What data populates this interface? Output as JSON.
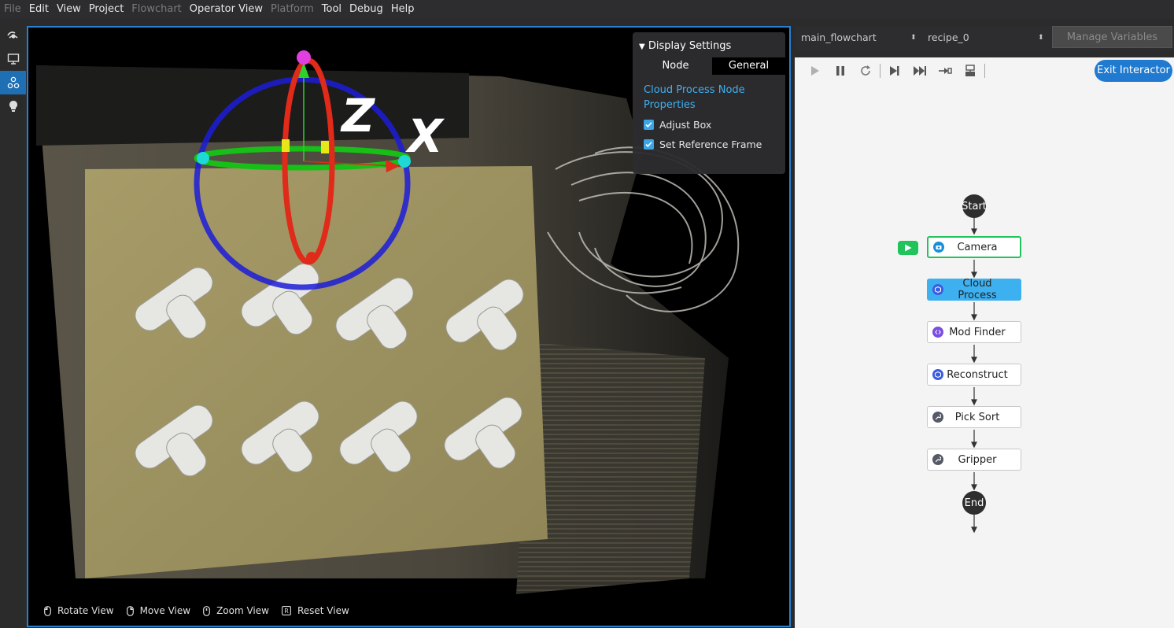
{
  "menu": [
    {
      "label": "File",
      "enabled": false
    },
    {
      "label": "Edit",
      "enabled": true
    },
    {
      "label": "View",
      "enabled": true
    },
    {
      "label": "Project",
      "enabled": true
    },
    {
      "label": "Flowchart",
      "enabled": false
    },
    {
      "label": "Operator View",
      "enabled": true
    },
    {
      "label": "Platform",
      "enabled": false
    },
    {
      "label": "Tool",
      "enabled": true
    },
    {
      "label": "Debug",
      "enabled": true
    },
    {
      "label": "Help",
      "enabled": true
    }
  ],
  "sidebar": {
    "items": [
      {
        "icon": "eye-icon",
        "active": false
      },
      {
        "icon": "monitor-icon",
        "active": false
      },
      {
        "icon": "flowchart-icon",
        "active": true
      },
      {
        "icon": "lightbulb-icon",
        "active": false
      }
    ]
  },
  "viewport": {
    "gizmo_labels": {
      "z": "Z",
      "x": "X"
    },
    "display_settings": {
      "title": "Display Settings",
      "tabs": [
        {
          "label": "Node",
          "active": false
        },
        {
          "label": "General",
          "active": true
        }
      ],
      "section_title": "Cloud Process Node Properties",
      "checkboxes": [
        {
          "label": "Adjust Box",
          "checked": true
        },
        {
          "label": "Set Reference Frame",
          "checked": true
        }
      ]
    },
    "hints": [
      {
        "icon": "mouse-left-icon",
        "label": "Rotate View"
      },
      {
        "icon": "mouse-right-icon",
        "label": "Move View"
      },
      {
        "icon": "mouse-wheel-icon",
        "label": "Zoom View"
      },
      {
        "icon": "key-r-icon",
        "label": "Reset View"
      }
    ]
  },
  "flow_panel": {
    "flowchart_select": "main_flowchart",
    "recipe_select": "recipe_0",
    "manage_variables": "Manage Variables",
    "exit_interactor": "Exit Interactor",
    "toolbar": [
      "play-icon",
      "pause-icon",
      "reset-icon",
      "step-icon",
      "fast-forward-icon",
      "step-into-icon",
      "breakpoint-icon"
    ],
    "start_label": "Start",
    "end_label": "End",
    "nodes": [
      {
        "label": "Camera",
        "icon": "camera-icon",
        "icon_color": "#1a8fd8",
        "state": "running"
      },
      {
        "label": "Cloud Process",
        "icon": "cube-icon",
        "icon_color": "#3b5de0",
        "state": "selected"
      },
      {
        "label": "Mod Finder",
        "icon": "code-icon",
        "icon_color": "#7b4fe0",
        "state": "normal"
      },
      {
        "label": "Reconstruct",
        "icon": "cube-icon",
        "icon_color": "#3b5de0",
        "state": "normal"
      },
      {
        "label": "Pick Sort",
        "icon": "wrench-icon",
        "icon_color": "#555a66",
        "state": "normal"
      },
      {
        "label": "Gripper",
        "icon": "wrench-icon",
        "icon_color": "#555a66",
        "state": "normal"
      }
    ]
  },
  "colors": {
    "accent": "#1f7ad0",
    "selected_node": "#3db0f0",
    "running": "#22c35a"
  }
}
